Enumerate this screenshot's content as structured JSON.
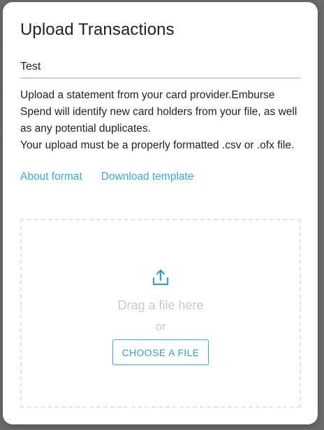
{
  "modal": {
    "title": "Upload Transactions",
    "name_value": "Test",
    "description": [
      "Upload a statement from your card provider.Emburse Spend will identify new card holders from your file, as well as any potential duplicates.",
      "Your upload must be a properly formatted .csv or .ofx file."
    ],
    "links": {
      "about_format": "About format",
      "download_template": "Download template"
    },
    "dropzone": {
      "icon": "upload-icon",
      "drag_text": "Drag a file here",
      "or_text": "or",
      "button_label": "CHOOSE A FILE"
    }
  },
  "colors": {
    "accent": "#35a8dc",
    "muted_text": "#c4cbd6",
    "border_dashed": "#dfe3ea"
  }
}
